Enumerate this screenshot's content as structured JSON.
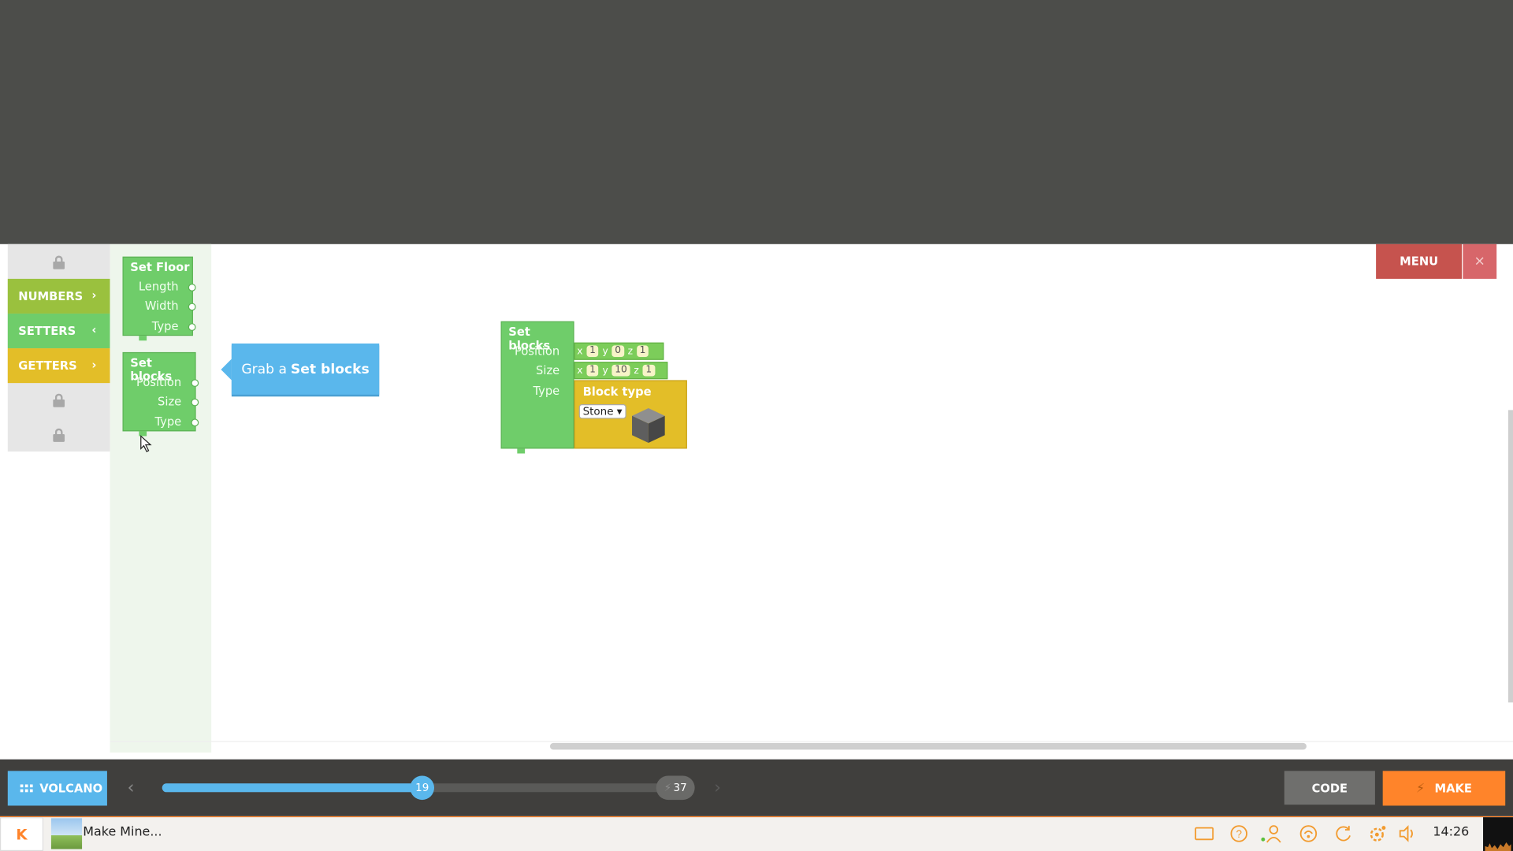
{
  "sidebar": {
    "categories": [
      {
        "label": "NUMBERS",
        "arrow": "›",
        "color": "#9ac13e"
      },
      {
        "label": "SETTERS",
        "arrow": "‹",
        "color": "#6fcd6a"
      },
      {
        "label": "GETTERS",
        "arrow": "›",
        "color": "#e3be28"
      }
    ]
  },
  "flyout": {
    "set_floor": {
      "title": "Set Floor",
      "inputs": [
        "Length",
        "Width",
        "Type"
      ]
    },
    "set_blocks": {
      "title": "Set blocks",
      "inputs": [
        "Position",
        "Size",
        "Type"
      ]
    }
  },
  "tooltip": {
    "prefix": "Grab a",
    "emphasis": "Set blocks"
  },
  "menu": {
    "label": "MENU",
    "close": "×"
  },
  "workspace": {
    "block": {
      "title": "Set blocks",
      "inputs": [
        "Position",
        "Size",
        "Type"
      ]
    },
    "position": {
      "x": "1",
      "y": "0",
      "z": "1"
    },
    "size": {
      "x": "1",
      "y": "10",
      "z": "1"
    },
    "axis_labels": {
      "x": "x",
      "y": "y",
      "z": "z"
    },
    "block_type": {
      "title": "Block type",
      "selected": "Stone ▾"
    }
  },
  "toolbar": {
    "world_button": "VOLCANO",
    "prev_icon": "chevron-left-icon",
    "next_icon": "chevron-right-icon",
    "current_step": "19",
    "total_steps": "37",
    "progress_fraction": 0.5,
    "code_label": "CODE",
    "make_label": "MAKE",
    "make_bolt": "⚡"
  },
  "taskbar": {
    "start": "K",
    "app_title": "Make Mine...",
    "clock": "14:26",
    "tray_icons": [
      "screen-icon",
      "help-icon",
      "user-icon",
      "network-icon",
      "updates-icon",
      "settings-icon",
      "volume-icon"
    ]
  },
  "colors": {
    "setters_green": "#6fcd6a",
    "value_yellow": "#e4cc2c",
    "accent_blue": "#5ab7ec",
    "make_orange": "#ff842a",
    "menu_red": "#c6534e"
  }
}
